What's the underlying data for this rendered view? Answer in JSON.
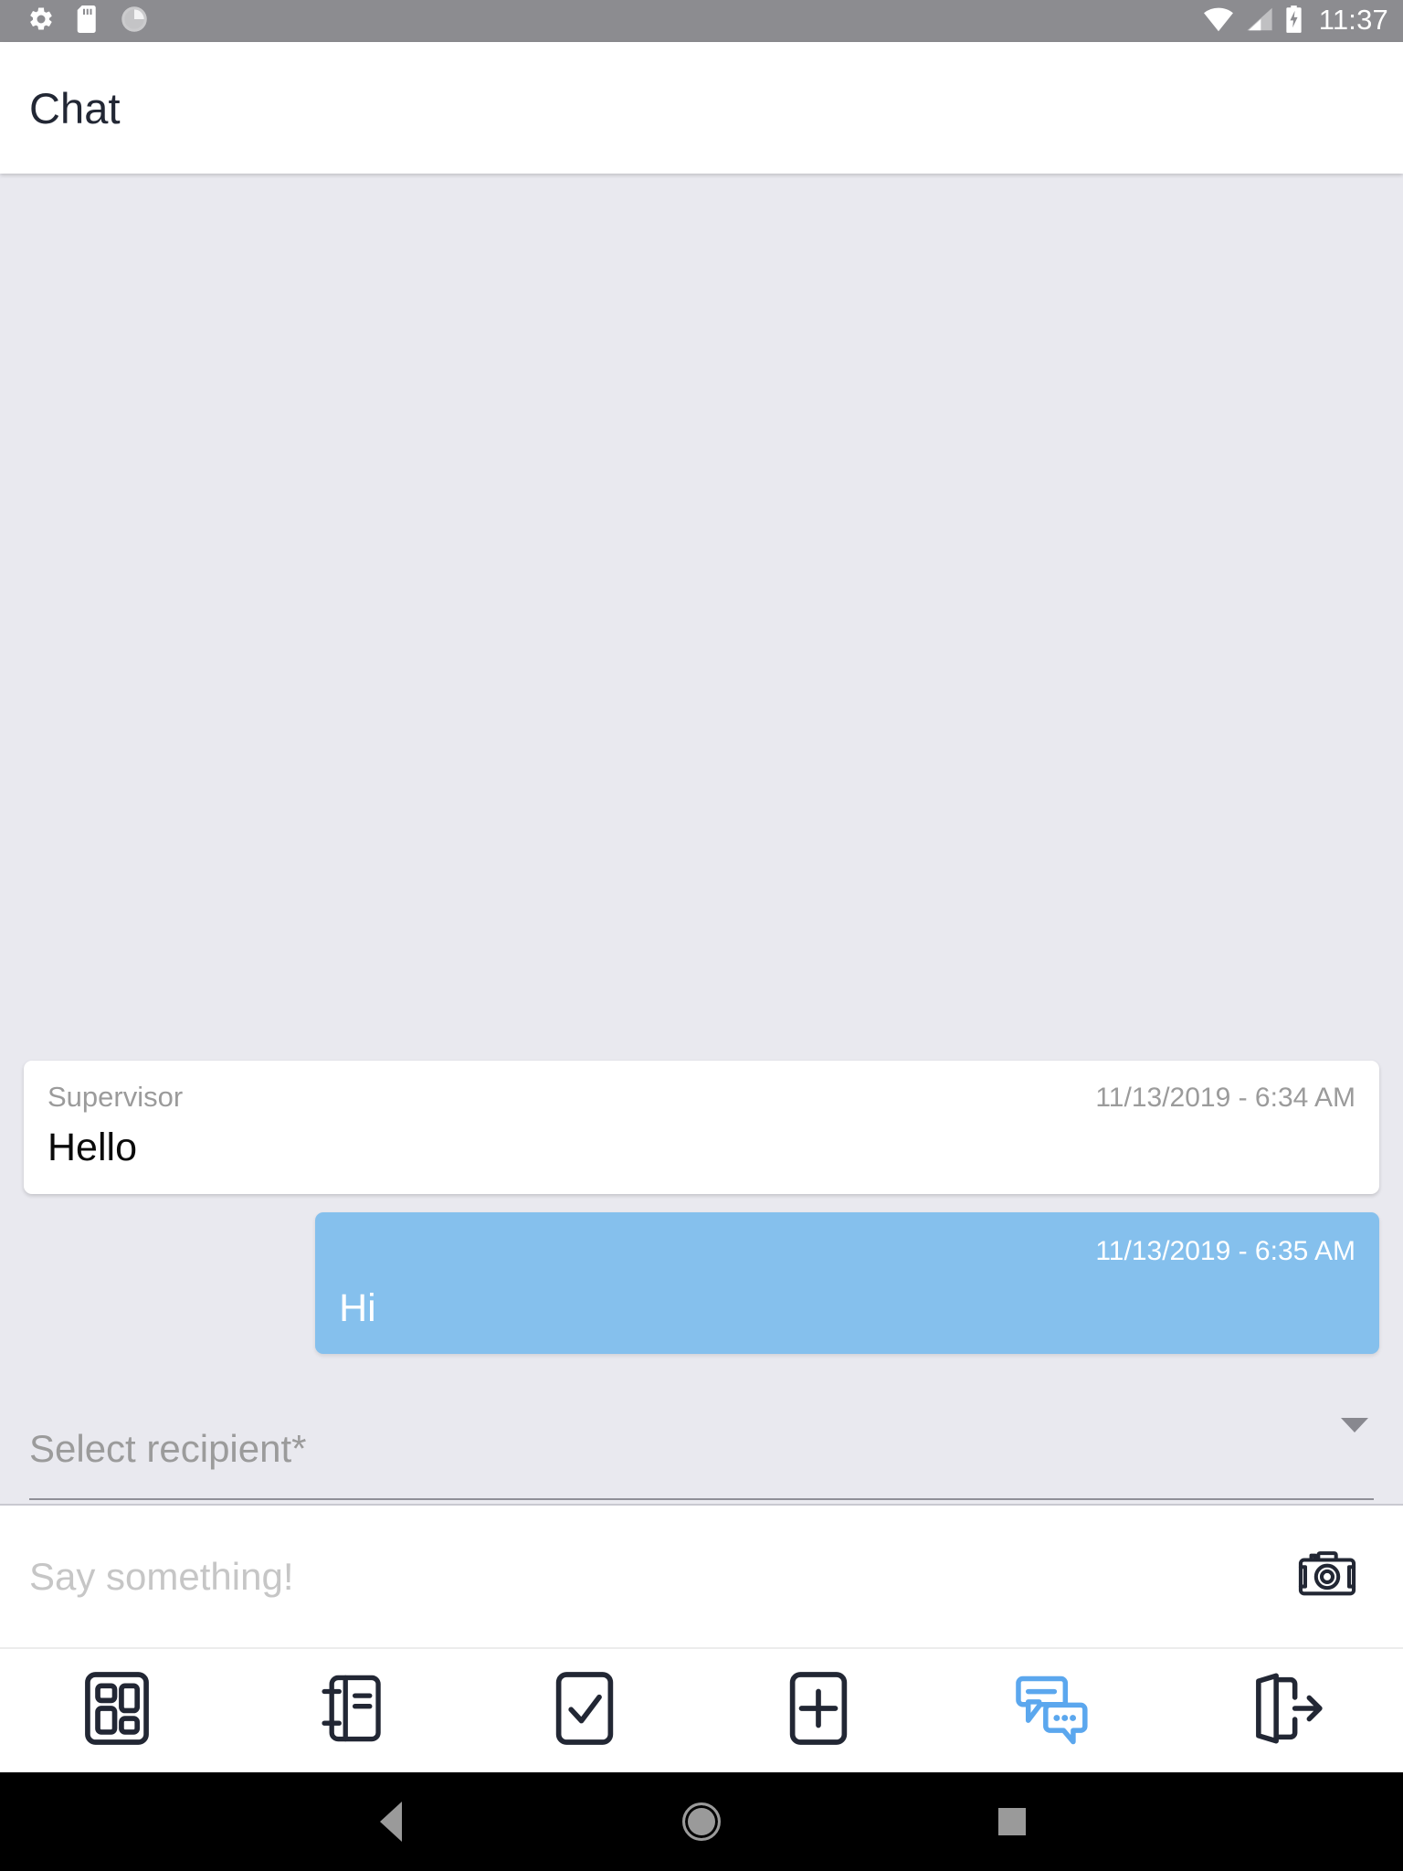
{
  "status_bar": {
    "time": "11:37",
    "left_icons": [
      "settings-gear-icon",
      "sd-card-icon",
      "sync-circle-icon"
    ],
    "right_icons": [
      "wifi-icon",
      "cell-signal-icon",
      "battery-charging-icon"
    ],
    "background": "#8c8c90"
  },
  "title_bar": {
    "title": "Chat"
  },
  "chat": {
    "background": "#e9e9ef",
    "messages": [
      {
        "direction": "incoming",
        "sender": "Supervisor",
        "timestamp": "11/13/2019 - 6:34 AM",
        "text": "Hello",
        "bubble_color": "#ffffff",
        "text_color": "#0a0a0a"
      },
      {
        "direction": "outgoing",
        "sender": "",
        "timestamp": "11/13/2019 - 6:35 AM",
        "text": "Hi",
        "bubble_color": "#85c0ed",
        "text_color": "#ffffff"
      }
    ]
  },
  "recipient_select": {
    "placeholder": "Select recipient*",
    "value": "",
    "caret_icon": "chevron-down-icon"
  },
  "message_input": {
    "placeholder": "Say something!",
    "value": "",
    "camera_icon": "camera-icon"
  },
  "bottom_nav": {
    "active_color": "#5ba7ee",
    "inactive_color": "#222734",
    "items": [
      {
        "name": "dashboard",
        "icon": "dashboard-grid-icon",
        "active": false
      },
      {
        "name": "journal",
        "icon": "notebook-icon",
        "active": false
      },
      {
        "name": "tasks",
        "icon": "checklist-icon",
        "active": false
      },
      {
        "name": "add",
        "icon": "plus-square-icon",
        "active": false
      },
      {
        "name": "chat",
        "icon": "chat-bubbles-icon",
        "active": true
      },
      {
        "name": "logout",
        "icon": "logout-door-icon",
        "active": false
      }
    ]
  },
  "system_nav": {
    "back": "back-triangle-icon",
    "home": "home-circle-icon",
    "recents": "recents-square-icon"
  }
}
